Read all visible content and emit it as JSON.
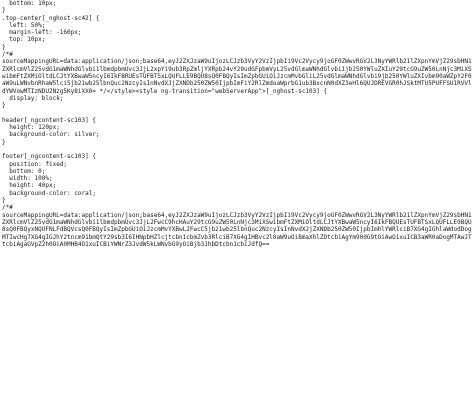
{
  "lines": [
    "  bottom: 10px;",
    "}",
    ".top-center[_nghost-sc42] {",
    "  left: 50%;",
    "  margin-left: -160px;",
    "  top: 10px;",
    "}",
    "/*#",
    "sourceMappingURL=data:application/json;base64,eyJ2ZXJzaW9uIjozLCJzb3VyY2VzIjpbIi9Vc2Vycy9joGF0ZWwvRGV2L3NyYWRlb21lZXpnYmVjZ29sbHN1ZXRlcmVlZ25vdG1maWNhdGlvbi1lbmdpbmUvc3JjL2xpYi9ub3RpZmljYXRpb24vY29udGFpbmVyL25vdGlmaWNhdGlvbi1jb250YWluZXIuY29tcG9uZW50LnNjc3MiXSwibmFtZXMiOltdLCJtYXBwaW5ncyI6IkFBRUEsTUFBTSxLQUFLLE9BQU8sQ0FBQyIsImZpbGUiOiJzcmMvbGliL25vdGlmaWNhdGlvbi9jb250YWluZXIvbm90aWZpY2F0aW9uLWNvbnRhaW5lci5jb21wb25lbnQuc2NzcyIsInNvdXJjZXNDb250ZW50IjpbImFiY2RlZmdoaWprbG1ub3BxcnN0dXZ3eHl6QUJDREVGR0hJSktMTU5PUFFSU1RVVldYWVowMTIzNDU2Nzg5Ky8iXX0= */</style><style ng-transition=\"webServerApp\">[_nghost-sc103] {",
    "  display: block;",
    "}",
    "",
    "header[_ngcontent-sc103] {",
    "  height: 120px;",
    "  background-color: silver;",
    "}",
    "",
    "footer[_ngcontent-sc103] {",
    "  position: fixed;",
    "  bottom: 0;",
    "  width: 100%;",
    "  height: 40px;",
    "  background-color: coral;",
    "}",
    "/*#",
    "sourceMappingURL=data:application/json;base64,eyJ2ZXJzaW9uIjozLCJzb3VyY2VzIjpbIi9Vc2Vycy9joGF0ZWwvRGV2L3NyYWRlb21lZXpnYmVjZ29sbHN1ZXRlcmVlZ25vdG1maWNhdGlvbi1lbmdpbmUvc3JjL2FwcC9hcHAuY29tcG9uZW50LnNjc3MiXSwibmFtZXMiOltdLCJtYXBwaW5ncyI6IkFBQUEsTUFBTSxLQUFLLE9BQU8sQ0FBQyxNQUFNLFdBQVcsQ0FBQyIsImZpbGUiOiJzcmMvYXBwL2FwcC5jb21wb25lbnQuc2NzcyIsInNvdXJjZXNDb250ZW50IjpbImhlYWRlciB7XG4gIGhlaWdodDogMTIwcHg7XG4gIGJhY2tncm91bmQtY29sb3I6IHNpbHZlcjtcbn1cbmZvb3RlciB7XG4gIHBvc2l0aW9uOiBmaXhlZDtcbiAgYm90dG9tOiAwO1xuICB3aWR0aDogMTAwJTtcbiAgaGVpZ2h0OiA0MHB4O1xuICBiYWNrZ3JvdW5kLWNvbG9yOiBjb3JhbDtcbn1cbiJdfQ=="
  ]
}
